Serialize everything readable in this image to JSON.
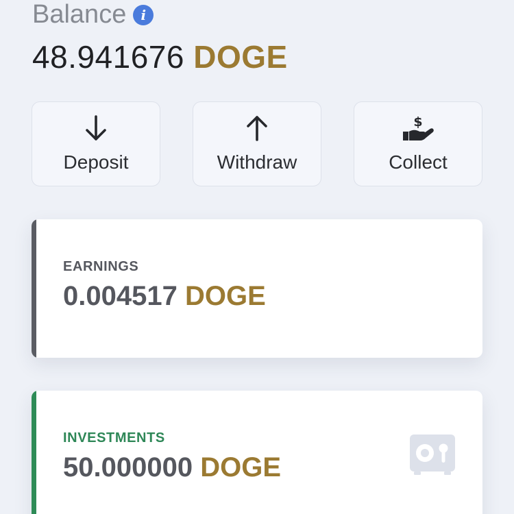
{
  "balance": {
    "label": "Balance",
    "amount": "48.941676",
    "currency": "DOGE"
  },
  "actions": [
    {
      "label": "Deposit",
      "icon": "arrow-down-icon"
    },
    {
      "label": "Withdraw",
      "icon": "arrow-up-icon"
    },
    {
      "label": "Collect",
      "icon": "hand-dollar-icon"
    }
  ],
  "earnings": {
    "title": "EARNINGS",
    "amount": "0.004517",
    "currency": "DOGE"
  },
  "investments": {
    "title": "INVESTMENTS",
    "amount": "50.000000",
    "currency": "DOGE",
    "icon": "safe-icon"
  },
  "colors": {
    "currency": "#9b7a32",
    "info": "#4a7bdc",
    "earnings_accent": "#5a5c63",
    "investments_accent": "#2e8b57"
  }
}
